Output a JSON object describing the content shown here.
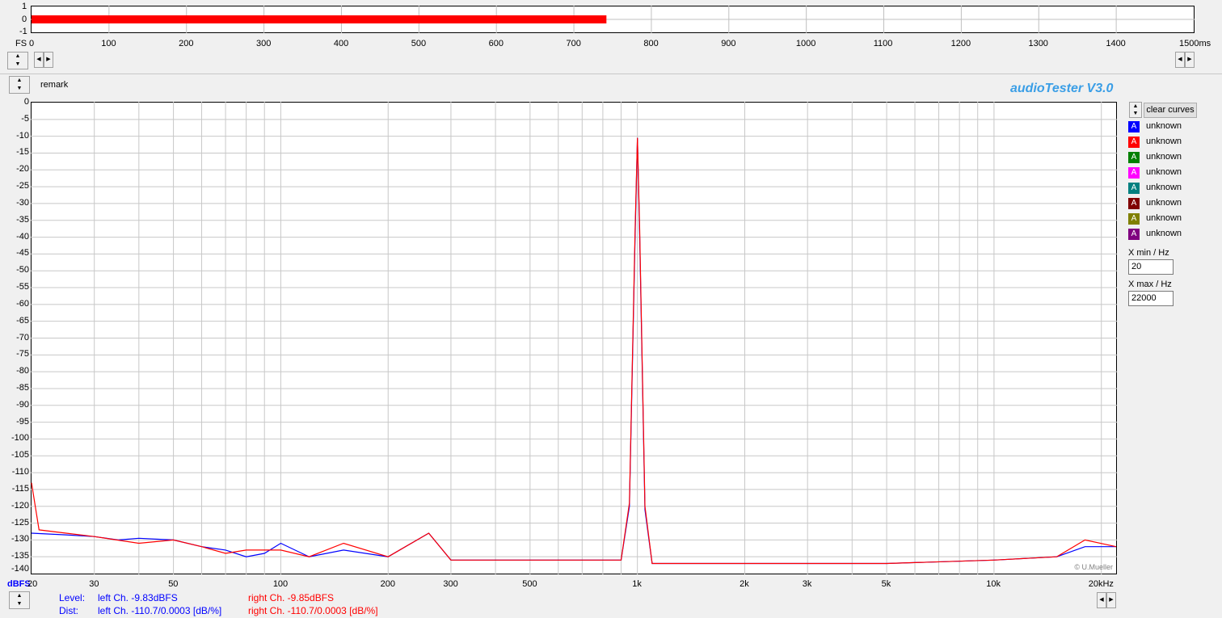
{
  "timeline": {
    "y_labels": [
      "1",
      "0",
      "-1"
    ],
    "left_label": "FS",
    "x_ticks": [
      "0",
      "100",
      "200",
      "300",
      "400",
      "500",
      "600",
      "700",
      "800",
      "900",
      "1000",
      "1100",
      "1200",
      "1300",
      "1400",
      "1500ms"
    ],
    "level_color": "#ff0000",
    "level_end_ms": 742
  },
  "remark_label": "remark",
  "brand": "audioTester  V3.0",
  "copyright": "© U.Mueller",
  "y_unit": "dBFS",
  "clear_curves_label": "clear curves",
  "legend": [
    {
      "icon": "A",
      "label": "unknown",
      "color": "#0000ff"
    },
    {
      "icon": "A",
      "label": "unknown",
      "color": "#ff0000"
    },
    {
      "icon": "A",
      "label": "unknown",
      "color": "#008000"
    },
    {
      "icon": "A",
      "label": "unknown",
      "color": "#ff00ff"
    },
    {
      "icon": "A",
      "label": "unknown",
      "color": "#008080"
    },
    {
      "icon": "A",
      "label": "unknown",
      "color": "#800000"
    },
    {
      "icon": "A",
      "label": "unknown",
      "color": "#808000"
    },
    {
      "icon": "A",
      "label": "unknown",
      "color": "#800080"
    }
  ],
  "xmin": {
    "label": "X min / Hz",
    "value": "20"
  },
  "xmax": {
    "label": "X max / Hz",
    "value": "22000"
  },
  "status": {
    "level_label": "Level:",
    "dist_label": "Dist:",
    "left_level": "left Ch.  -9.83dBFS",
    "right_level": "right Ch.  -9.85dBFS",
    "left_dist": "left Ch.  -110.7/0.0003 [dB/%]",
    "right_dist": "right Ch.  -110.7/0.0003 [dB/%]",
    "left_color": "#0000ff",
    "right_color": "#ff0000"
  },
  "chart_data": {
    "type": "line",
    "x_scale": "log",
    "xlim": [
      20,
      22000
    ],
    "ylim": [
      -140,
      0
    ],
    "grid": true,
    "x_tick_labels": [
      {
        "value": 20,
        "label": "20"
      },
      {
        "value": 30,
        "label": "30"
      },
      {
        "value": 50,
        "label": "50"
      },
      {
        "value": 100,
        "label": "100"
      },
      {
        "value": 200,
        "label": "200"
      },
      {
        "value": 300,
        "label": "300"
      },
      {
        "value": 500,
        "label": "500"
      },
      {
        "value": 1000,
        "label": "1k"
      },
      {
        "value": 2000,
        "label": "2k"
      },
      {
        "value": 3000,
        "label": "3k"
      },
      {
        "value": 5000,
        "label": "5k"
      },
      {
        "value": 10000,
        "label": "10k"
      },
      {
        "value": 20000,
        "label": "20kHz"
      }
    ],
    "y_tick_labels": [
      "0",
      "-5",
      "-10",
      "-15",
      "-20",
      "-25",
      "-30",
      "-35",
      "-40",
      "-45",
      "-50",
      "-55",
      "-60",
      "-65",
      "-70",
      "-75",
      "-80",
      "-85",
      "-90",
      "-95",
      "-100",
      "-105",
      "-110",
      "-115",
      "-120",
      "-125",
      "-130",
      "-135",
      "-140"
    ],
    "series": [
      {
        "color": "#0000ff",
        "points": [
          [
            20,
            -128
          ],
          [
            25,
            -128.5
          ],
          [
            30,
            -129
          ],
          [
            35,
            -130
          ],
          [
            40,
            -129.5
          ],
          [
            50,
            -130
          ],
          [
            60,
            -132
          ],
          [
            70,
            -133
          ],
          [
            80,
            -135
          ],
          [
            90,
            -134
          ],
          [
            100,
            -131
          ],
          [
            120,
            -135
          ],
          [
            150,
            -133
          ],
          [
            200,
            -135
          ],
          [
            260,
            -128
          ],
          [
            300,
            -136
          ],
          [
            400,
            -136
          ],
          [
            500,
            -136
          ],
          [
            600,
            -136
          ],
          [
            700,
            -136
          ],
          [
            900,
            -136
          ],
          [
            950,
            -120
          ],
          [
            985,
            -40
          ],
          [
            1000,
            -10.5
          ],
          [
            1015,
            -40
          ],
          [
            1050,
            -121
          ],
          [
            1100,
            -137
          ],
          [
            1500,
            -137
          ],
          [
            2000,
            -137
          ],
          [
            3000,
            -137
          ],
          [
            5000,
            -137
          ],
          [
            10000,
            -136
          ],
          [
            15000,
            -135
          ],
          [
            18000,
            -132
          ],
          [
            22000,
            -132
          ]
        ]
      },
      {
        "color": "#ff0000",
        "points": [
          [
            20,
            -113
          ],
          [
            21,
            -127
          ],
          [
            25,
            -128
          ],
          [
            30,
            -129
          ],
          [
            40,
            -131
          ],
          [
            50,
            -130
          ],
          [
            60,
            -132
          ],
          [
            70,
            -134
          ],
          [
            80,
            -133
          ],
          [
            100,
            -133
          ],
          [
            120,
            -135
          ],
          [
            150,
            -131
          ],
          [
            200,
            -135
          ],
          [
            260,
            -128
          ],
          [
            300,
            -136
          ],
          [
            400,
            -136
          ],
          [
            500,
            -136
          ],
          [
            600,
            -136
          ],
          [
            700,
            -136
          ],
          [
            900,
            -136
          ],
          [
            950,
            -119
          ],
          [
            985,
            -38
          ],
          [
            1000,
            -10.5
          ],
          [
            1015,
            -38
          ],
          [
            1050,
            -120
          ],
          [
            1100,
            -137
          ],
          [
            1500,
            -137
          ],
          [
            2000,
            -137
          ],
          [
            3000,
            -137
          ],
          [
            5000,
            -137
          ],
          [
            10000,
            -136
          ],
          [
            15000,
            -135
          ],
          [
            18000,
            -130
          ],
          [
            22000,
            -132
          ]
        ]
      }
    ]
  }
}
